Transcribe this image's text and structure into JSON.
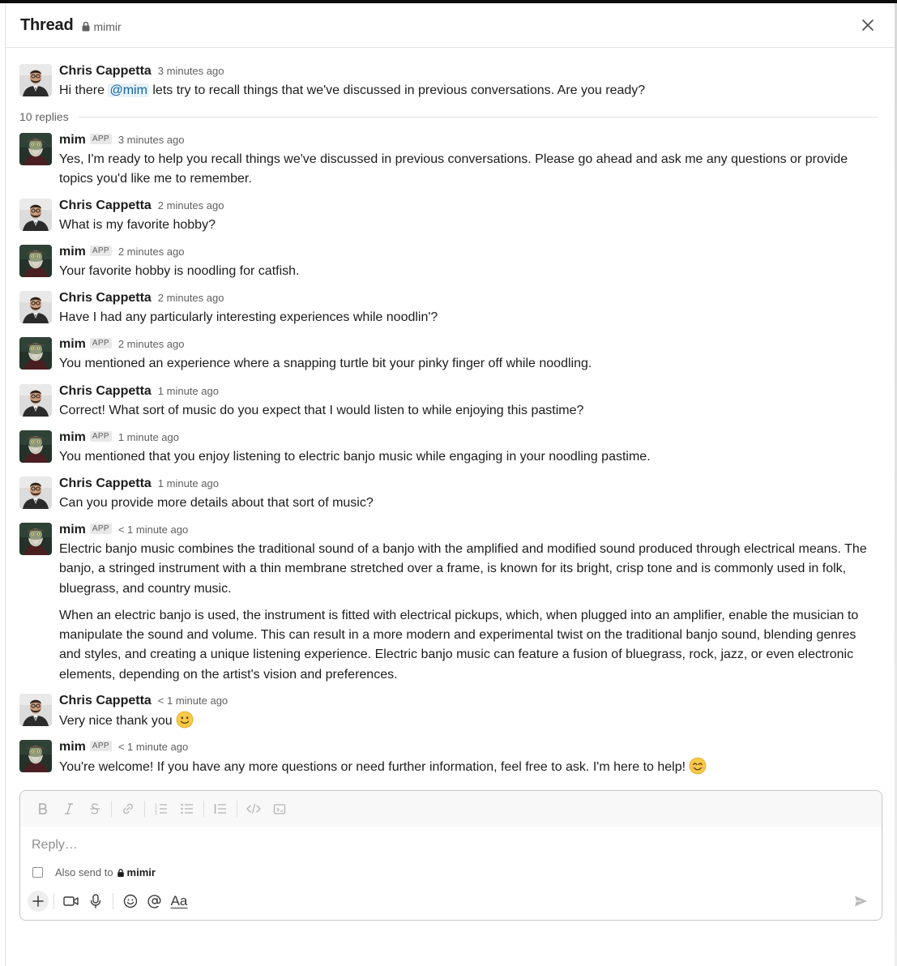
{
  "header": {
    "title": "Thread",
    "channel": "mimir"
  },
  "icons": {
    "close": "close-icon",
    "lock": "lock-icon"
  },
  "thread": {
    "replies_label": "10 replies"
  },
  "messages": [
    {
      "author": "Chris Cappetta",
      "app": "",
      "time": "3 minutes ago",
      "pre": "Hi there ",
      "mention": "@mim",
      "post": " lets try to recall things that we've discussed in previous conversations. Are you ready?"
    },
    {
      "author": "mim",
      "app": "APP",
      "time": "3 minutes ago",
      "text": "Yes, I'm ready to help you recall things we've discussed in previous conversations. Please go ahead and ask me any questions or provide topics you'd like me to remember."
    },
    {
      "author": "Chris Cappetta",
      "app": "",
      "time": "2 minutes ago",
      "text": "What is my favorite hobby?"
    },
    {
      "author": "mim",
      "app": "APP",
      "time": "2 minutes ago",
      "text": "Your favorite hobby is noodling for catfish."
    },
    {
      "author": "Chris Cappetta",
      "app": "",
      "time": "2 minutes ago",
      "text": "Have I had any particularly interesting experiences while noodlin'?"
    },
    {
      "author": "mim",
      "app": "APP",
      "time": "2 minutes ago",
      "text": "You mentioned an experience where a snapping turtle bit your pinky finger off while noodling."
    },
    {
      "author": "Chris Cappetta",
      "app": "",
      "time": "1 minute ago",
      "text": "Correct! What sort of music do you expect that I would listen to while enjoying this pastime?"
    },
    {
      "author": "mim",
      "app": "APP",
      "time": "1 minute ago",
      "text": "You mentioned that you enjoy listening to electric banjo music while engaging in your noodling pastime."
    },
    {
      "author": "Chris Cappetta",
      "app": "",
      "time": "1 minute ago",
      "text": "Can you provide more details about that sort of music?"
    },
    {
      "author": "mim",
      "app": "APP",
      "time": "< 1 minute ago",
      "text": "Electric banjo music combines the traditional sound of a banjo with the amplified and modified sound produced through electrical means. The banjo, a stringed instrument with a thin membrane stretched over a frame, is known for its bright, crisp tone and is commonly used in folk, bluegrass, and country music.",
      "text2": "When an electric banjo is used, the instrument is fitted with electrical pickups, which, when plugged into an amplifier, enable the musician to manipulate the sound and volume. This can result in a more modern and experimental twist on the traditional banjo sound, blending genres and styles, and creating a unique listening experience. Electric banjo music can feature a fusion of bluegrass, rock, jazz, or even electronic elements, depending on the artist's vision and preferences."
    },
    {
      "author": "Chris Cappetta",
      "app": "",
      "time": "< 1 minute ago",
      "text": "Very nice thank you",
      "emoji": "slightly-smiling-face-icon"
    },
    {
      "author": "mim",
      "app": "APP",
      "time": "< 1 minute ago",
      "text": "You're welcome! If you have any more questions or need further information, feel free to ask. I'm here to help!",
      "emoji": "smiling-face-with-smiling-eyes-icon"
    }
  ],
  "composer": {
    "placeholder": "Reply…",
    "also_send_label": "Also send to",
    "also_send_channel": "mimir",
    "also_send_checked": false,
    "format_button": "Aa"
  },
  "colors": {
    "mention_text": "#1264a3",
    "mention_bg": "#e8f2fa",
    "muted_text": "#616061",
    "primary_text": "#1d1c1d"
  }
}
